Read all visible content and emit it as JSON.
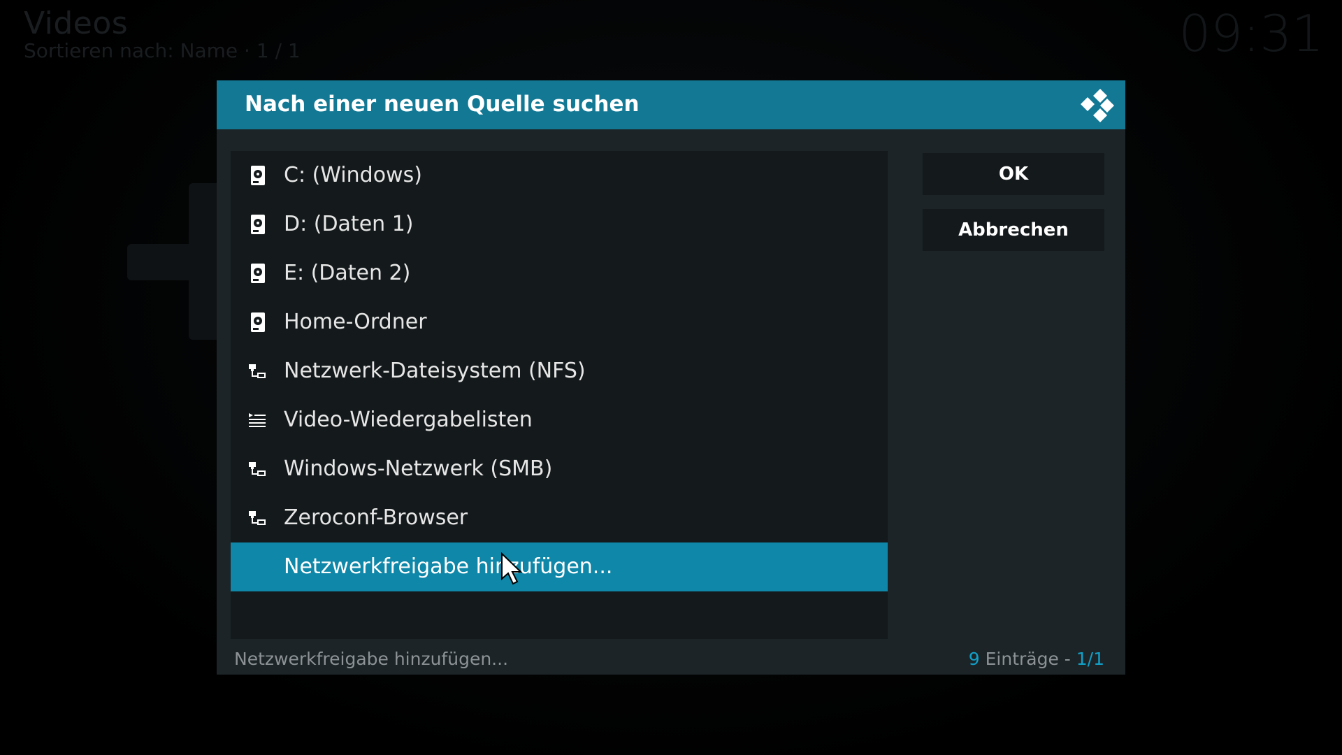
{
  "background": {
    "title": "Videos",
    "subtitle": "Sortieren nach: Name  ·  1 / 1",
    "clock": "09:31"
  },
  "dialog": {
    "title": "Nach einer neuen Quelle suchen",
    "logo_icon": "kodi-logo-icon",
    "items": [
      {
        "label": "C: (Windows)",
        "icon": "harddisk-icon"
      },
      {
        "label": "D: (Daten 1)",
        "icon": "harddisk-icon"
      },
      {
        "label": "E: (Daten 2)",
        "icon": "harddisk-icon"
      },
      {
        "label": "Home-Ordner",
        "icon": "harddisk-icon"
      },
      {
        "label": "Netzwerk-Dateisystem (NFS)",
        "icon": "network-icon"
      },
      {
        "label": "Video-Wiedergabelisten",
        "icon": "playlist-icon"
      },
      {
        "label": "Windows-Netzwerk (SMB)",
        "icon": "network-icon"
      },
      {
        "label": "Zeroconf-Browser",
        "icon": "network-icon"
      },
      {
        "label": "Netzwerkfreigabe hinzufügen...",
        "icon": "",
        "selected": true
      }
    ],
    "ok_label": "OK",
    "cancel_label": "Abbrechen",
    "footer": {
      "selected_label": "Netzwerkfreigabe hinzufügen...",
      "count": "9",
      "count_suffix": " Einträge - ",
      "page": "1/1"
    }
  },
  "colors": {
    "header": "#127894",
    "selected": "#0f87a8",
    "accent": "#12a0c8",
    "dialog_bg": "#1c2427",
    "panel_bg": "#14191b"
  }
}
